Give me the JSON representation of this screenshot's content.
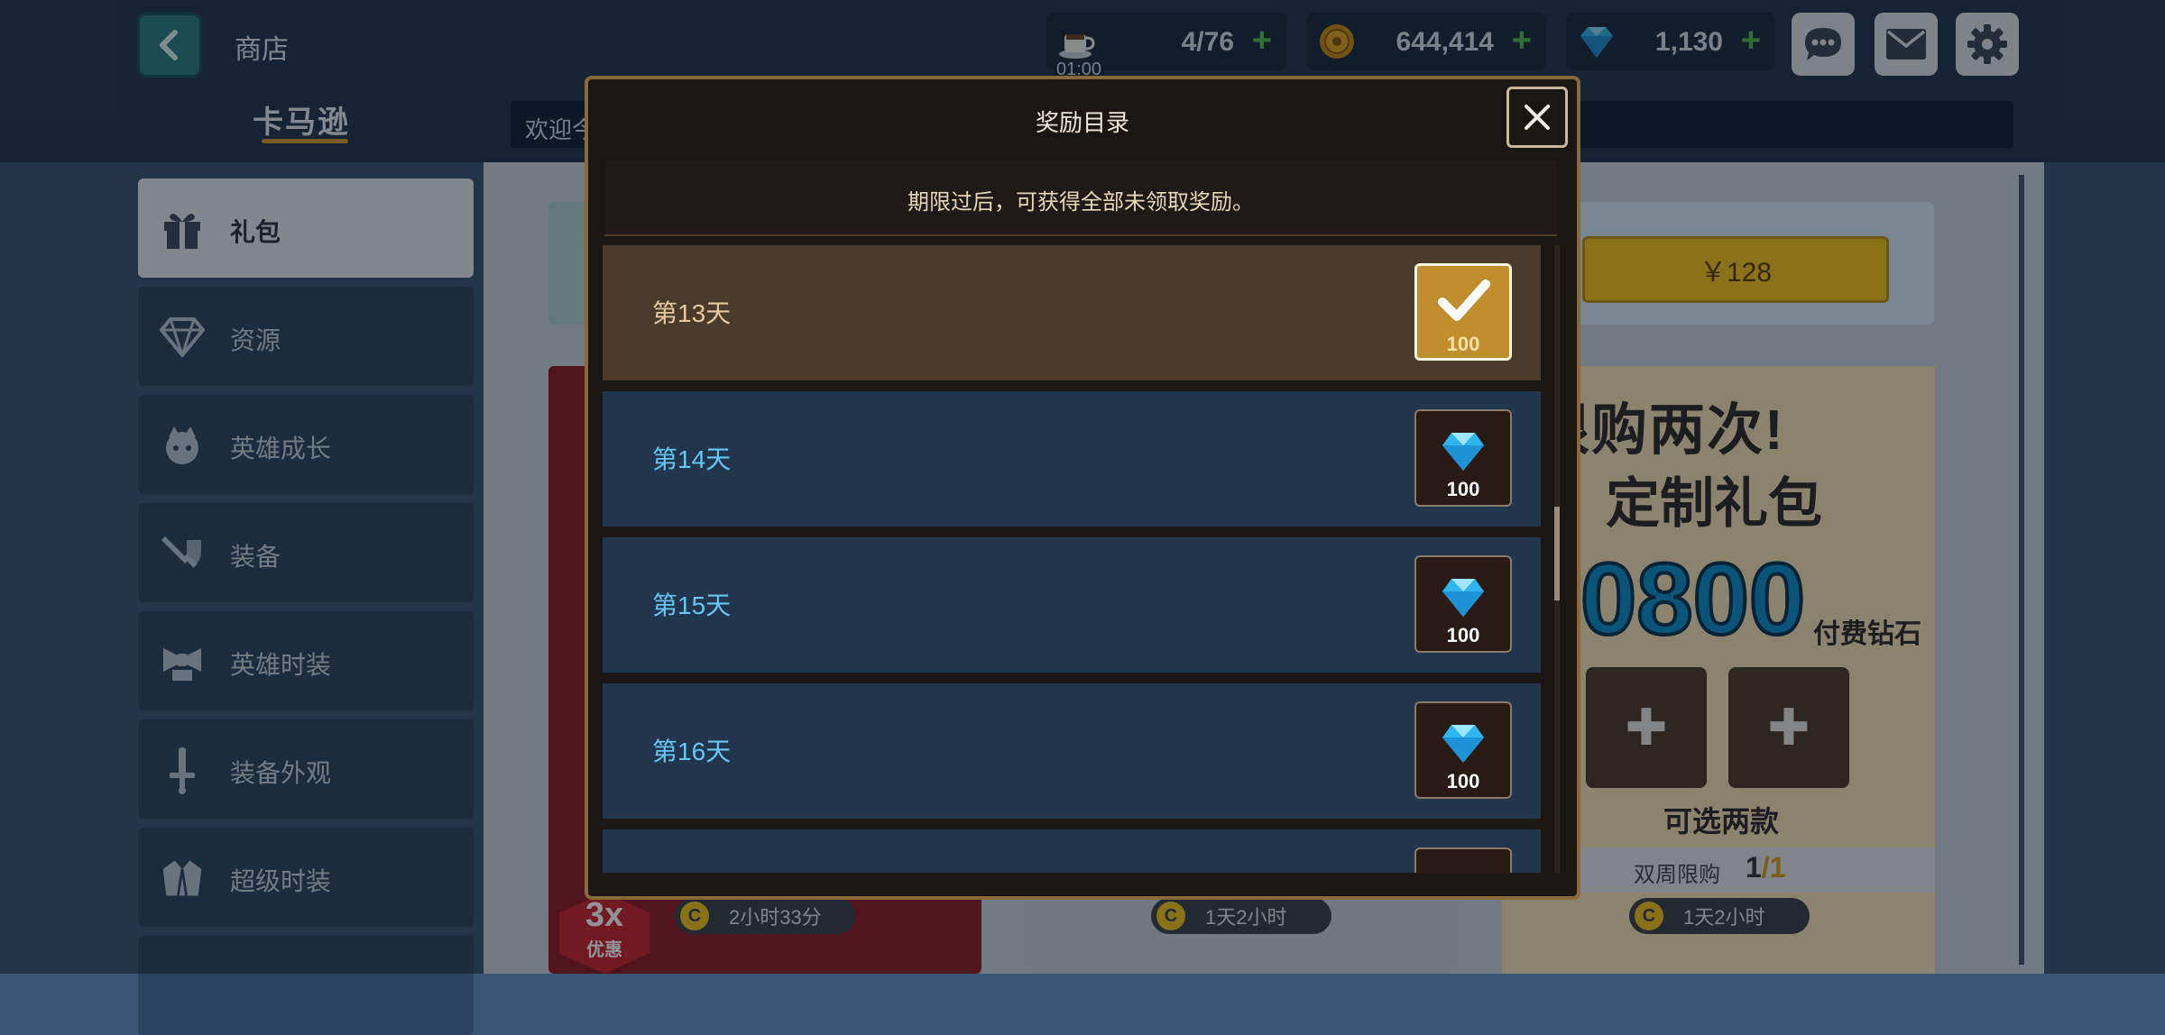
{
  "header": {
    "title": "商店",
    "brand": "卡马逊",
    "ticker": "欢迎今",
    "stamina": {
      "value": "4/76",
      "timer": "01:00",
      "icon": "coffee-cup-icon"
    },
    "coins": {
      "value": "644,414",
      "icon": "coin-icon"
    },
    "diamonds": {
      "value": "1,130",
      "icon": "diamond-icon"
    },
    "buttons": [
      "chat-icon",
      "mail-icon",
      "gear-icon"
    ]
  },
  "sidebar": {
    "items": [
      {
        "label": "礼包",
        "icon": "gift-icon",
        "active": true
      },
      {
        "label": "资源",
        "icon": "diamond-icon"
      },
      {
        "label": "英雄成长",
        "icon": "hero-face-icon"
      },
      {
        "label": "装备",
        "icon": "sword-shield-icon"
      },
      {
        "label": "英雄时装",
        "icon": "bowtie-costume-icon"
      },
      {
        "label": "装备外观",
        "icon": "sword-skin-icon"
      },
      {
        "label": "超级时装",
        "icon": "robe-icon"
      }
    ]
  },
  "shop": {
    "price_button": "￥128",
    "promo": {
      "title_line1": "限购两次!",
      "title_line2": "定制礼包",
      "amount": "0800",
      "paid_label": "付费钻石",
      "pick_label": "可选两款",
      "limit_label": "双周限购",
      "limit_count": "1",
      "limit_total": "/1"
    },
    "timers": [
      "2小时33分",
      "1天2小时",
      "1天2小时"
    ],
    "badge": {
      "value": "3x",
      "label": "优惠"
    }
  },
  "modal": {
    "title": "奖励目录",
    "notice": "期限过后，可获得全部未领取奖励。",
    "rows": [
      {
        "day": "第13天",
        "amount": "100",
        "claimed": true
      },
      {
        "day": "第14天",
        "amount": "100",
        "claimed": false
      },
      {
        "day": "第15天",
        "amount": "100",
        "claimed": false
      },
      {
        "day": "第16天",
        "amount": "100",
        "claimed": false
      },
      {
        "day": "",
        "amount": "",
        "claimed": false
      }
    ]
  },
  "colors": {
    "accent": "#d39b2f",
    "diamond": "#2fb6ef",
    "claimed_bg": "#4a3a2a",
    "row_bg": "#21364d"
  }
}
